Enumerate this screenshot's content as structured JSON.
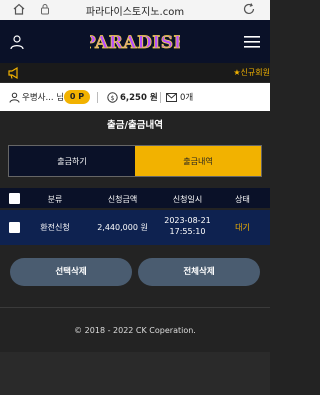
{
  "browser": {
    "url": "파라다이스토지노.com"
  },
  "header": {
    "logo_text": "PARADISE"
  },
  "notice": {
    "text": "★신규회원"
  },
  "user": {
    "name": "우병사...",
    "name_suffix": "님",
    "points": "0 P",
    "balance": "6,250 원",
    "messages": "0개"
  },
  "page": {
    "title": "출금/출금내역"
  },
  "tabs": [
    {
      "label": "출금하기",
      "active": false
    },
    {
      "label": "출금내역",
      "active": true
    }
  ],
  "table": {
    "headers": [
      "분류",
      "신청금액",
      "신청일시",
      "상태"
    ],
    "rows": [
      {
        "category": "환전신청",
        "amount": "2,440,000 원",
        "date": "2023-08-21",
        "time": "17:55:10",
        "status": "대기"
      }
    ]
  },
  "buttons": {
    "delete_selected": "선택삭제",
    "delete_all": "전체삭제"
  },
  "footer": {
    "copyright": "© 2018 - 2022 CK Coperation."
  },
  "colors": {
    "accent": "#f2b200",
    "navy": "#0a1128",
    "row": "#0e2250",
    "status_waiting": "#f2b200"
  }
}
